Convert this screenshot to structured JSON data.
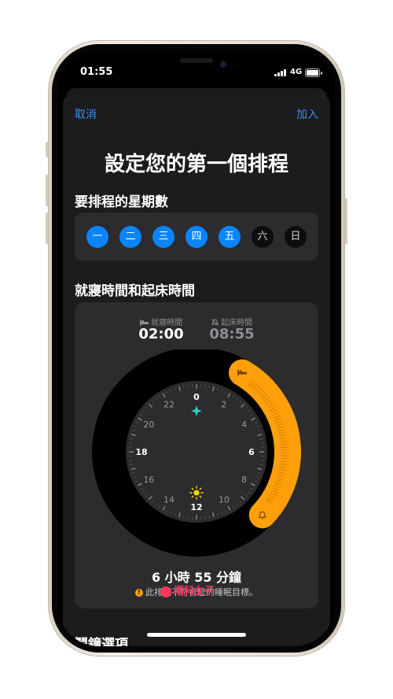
{
  "status_bar": {
    "time": "01:55",
    "network": "4G"
  },
  "nav": {
    "cancel": "取消",
    "add": "加入"
  },
  "title": "設定您的第一個排程",
  "days_section": {
    "title": "要排程的星期數",
    "days": [
      {
        "label": "一",
        "selected": true
      },
      {
        "label": "二",
        "selected": true
      },
      {
        "label": "三",
        "selected": true
      },
      {
        "label": "四",
        "selected": true
      },
      {
        "label": "五",
        "selected": true
      },
      {
        "label": "六",
        "selected": false
      },
      {
        "label": "日",
        "selected": false
      }
    ]
  },
  "schedule_section": {
    "title": "就寢時間和起床時間",
    "bedtime": {
      "label": "就寢時間",
      "value": "02:00"
    },
    "wake": {
      "label": "起床時間",
      "value": "08:55"
    },
    "clock_labels": [
      "0",
      "2",
      "4",
      "6",
      "8",
      "10",
      "12",
      "14",
      "16",
      "18",
      "20",
      "22"
    ],
    "range_start_hour": 2,
    "range_end_hour": 8.9167,
    "duration": "6 小時 55 分鐘",
    "warning": "此排程不符合您的睡眠目標。"
  },
  "alarm_section": {
    "title": "鬧鐘選項"
  },
  "watermark": "塔科女子",
  "colors": {
    "accent": "#0a84ff",
    "range": "#ff9f0a",
    "background": "#1c1c1e"
  }
}
